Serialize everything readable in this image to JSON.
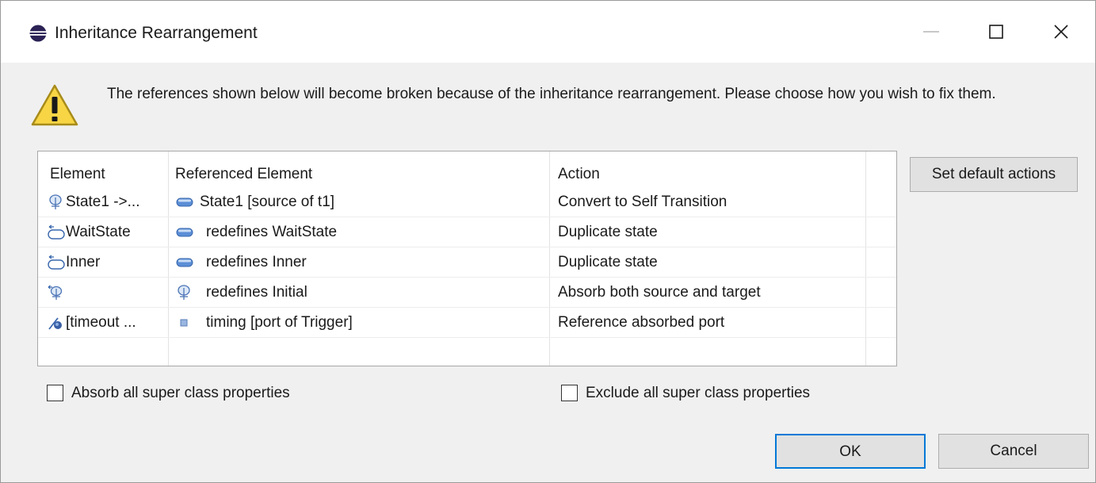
{
  "dialog": {
    "title": "Inheritance Rearrangement",
    "message": "The references shown below will become broken because of the inheritance rearrangement. Please choose how you wish to fix them."
  },
  "table": {
    "headers": [
      "Element",
      "Referenced Element",
      "Action"
    ],
    "rows": [
      {
        "element": "State1 ->...",
        "element_icon": "transition-icon",
        "referenced": "State1 [source of t1]",
        "referenced_icon": "state-icon",
        "action": "Convert to Self Transition"
      },
      {
        "element": "WaitState",
        "element_icon": "redefined-state-icon",
        "referenced": "redefines WaitState",
        "referenced_icon": "state-icon",
        "action": "Duplicate state"
      },
      {
        "element": "Inner",
        "element_icon": "redefined-state-icon",
        "referenced": "redefines Inner",
        "referenced_icon": "state-icon",
        "action": "Duplicate state"
      },
      {
        "element": "",
        "element_icon": "redefined-transition-icon",
        "referenced": "redefines Initial",
        "referenced_icon": "transition-icon",
        "action": "Absorb both source and target"
      },
      {
        "element": "[timeout ...",
        "element_icon": "trigger-icon",
        "referenced": "timing [port of Trigger]",
        "referenced_icon": "port-icon",
        "action": "Reference absorbed port"
      }
    ]
  },
  "buttons": {
    "set_default": "Set default actions",
    "ok": "OK",
    "cancel": "Cancel"
  },
  "options": {
    "absorb_label": "Absorb all super class properties",
    "absorb_checked": false,
    "exclude_label": "Exclude all super class properties",
    "exclude_checked": false
  }
}
